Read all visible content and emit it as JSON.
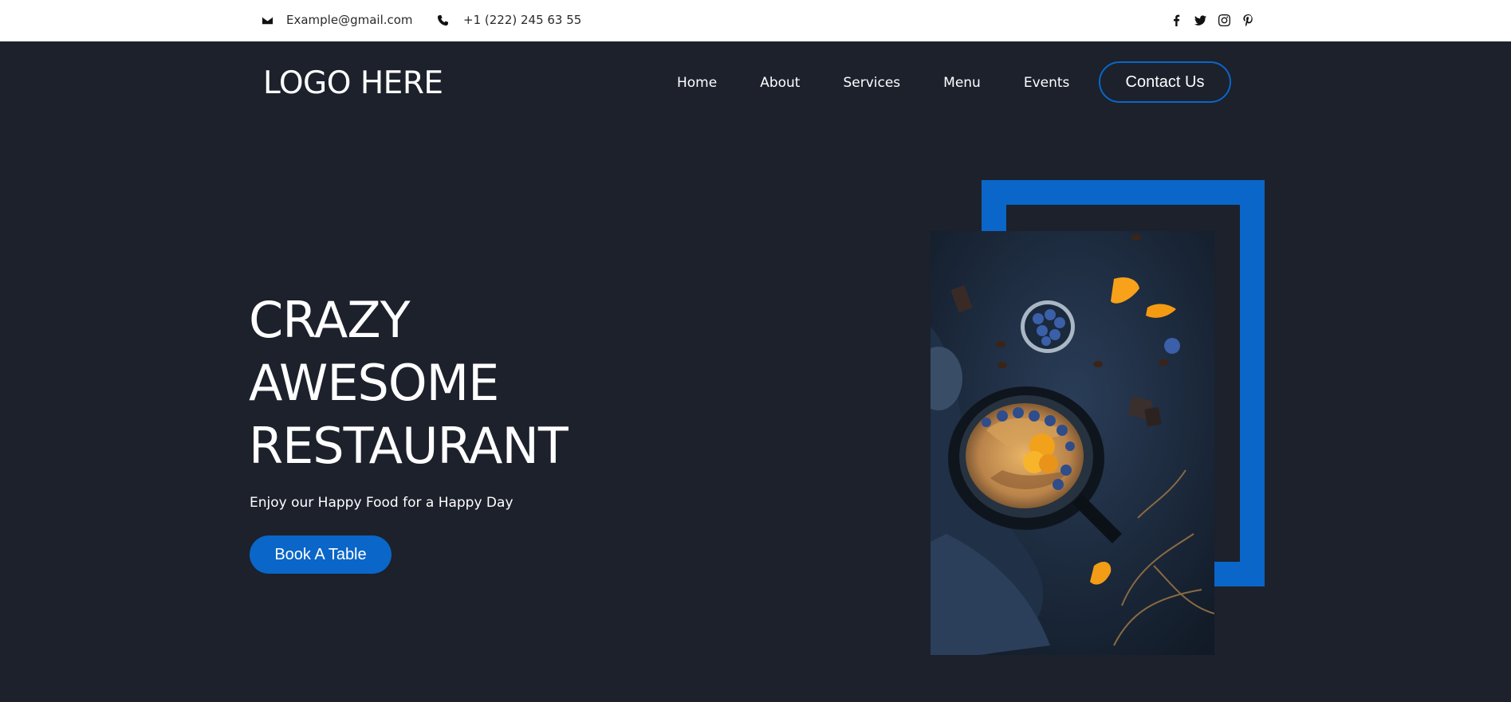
{
  "topbar": {
    "email": "Example@gmail.com",
    "phone": "+1 (222) 245 63 55",
    "email_icon": "envelope-icon",
    "phone_icon": "phone-icon",
    "socials": [
      "facebook-icon",
      "twitter-icon",
      "instagram-icon",
      "pinterest-icon"
    ]
  },
  "header": {
    "logo": "LOGO HERE",
    "nav": [
      "Home",
      "About",
      "Services",
      "Menu",
      "Events"
    ],
    "contact_button": "Contact Us"
  },
  "hero": {
    "title_lines": [
      "CRAZY",
      "AWESOME",
      "RESTAURANT"
    ],
    "subtitle": "Enjoy our Happy Food for a Happy Day",
    "cta": "Book A Table"
  },
  "colors": {
    "background": "#1c212c",
    "accent": "#0a66c8",
    "topbar": "#ffffff"
  }
}
